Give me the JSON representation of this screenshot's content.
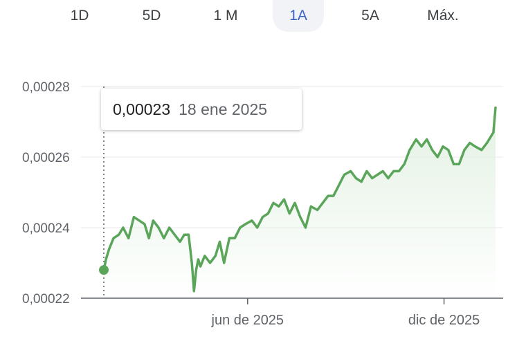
{
  "range_tabs": [
    {
      "label": "1D",
      "active": false
    },
    {
      "label": "5D",
      "active": false
    },
    {
      "label": "1 M",
      "active": false
    },
    {
      "label": "1A",
      "active": true
    },
    {
      "label": "5A",
      "active": false
    },
    {
      "label": "Máx.",
      "active": false
    }
  ],
  "tooltip": {
    "value": "0,00023",
    "date": "18 ene 2025"
  },
  "colors": {
    "line": "#5aa55a",
    "fill": "#e3f1e3",
    "grid": "#e8eaed",
    "axis": "#5f6368",
    "active_tab_text": "#3b62c7",
    "active_tab_bg": "#f1f3f6"
  },
  "chart_data": {
    "type": "area",
    "title": "",
    "xlabel": "",
    "ylabel": "",
    "grid": true,
    "legend": "none",
    "ylim": [
      0.00022,
      0.00028
    ],
    "yticks": [
      0.00022,
      0.00024,
      0.00026,
      0.00028
    ],
    "ytick_labels": [
      "0,00022",
      "0,00024",
      "0,00026",
      "0,00028"
    ],
    "xlim": [
      "2025-01-18",
      "2026-01-18"
    ],
    "xticks": [
      "2025-06-01",
      "2025-12-01"
    ],
    "xtick_labels": [
      "jun de 2025",
      "dic de 2025"
    ],
    "highlight": {
      "x": "2025-01-18",
      "y": 0.000228
    },
    "series": [
      {
        "x": [
          "2025-01-18",
          "2025-01-20",
          "2025-01-23",
          "2025-01-27",
          "2025-02-01",
          "2025-02-05",
          "2025-02-10",
          "2025-02-15",
          "2025-02-20",
          "2025-02-25",
          "2025-03-01",
          "2025-03-05",
          "2025-03-10",
          "2025-03-15",
          "2025-03-20",
          "2025-03-25",
          "2025-03-30",
          "2025-04-03",
          "2025-04-07",
          "2025-04-10",
          "2025-04-12",
          "2025-04-14",
          "2025-04-16",
          "2025-04-18",
          "2025-04-22",
          "2025-04-27",
          "2025-05-02",
          "2025-05-06",
          "2025-05-10",
          "2025-05-15",
          "2025-05-20",
          "2025-05-25",
          "2025-05-30",
          "2025-06-05",
          "2025-06-10",
          "2025-06-15",
          "2025-06-20",
          "2025-06-25",
          "2025-06-30",
          "2025-07-05",
          "2025-07-10",
          "2025-07-15",
          "2025-07-20",
          "2025-07-25",
          "2025-07-30",
          "2025-08-05",
          "2025-08-10",
          "2025-08-15",
          "2025-08-20",
          "2025-08-25",
          "2025-08-30",
          "2025-09-05",
          "2025-09-10",
          "2025-09-15",
          "2025-09-20",
          "2025-09-25",
          "2025-09-30",
          "2025-10-05",
          "2025-10-10",
          "2025-10-15",
          "2025-10-20",
          "2025-10-25",
          "2025-10-30",
          "2025-11-05",
          "2025-11-10",
          "2025-11-15",
          "2025-11-20",
          "2025-11-25",
          "2025-11-30",
          "2025-12-05",
          "2025-12-10",
          "2025-12-15",
          "2025-12-20",
          "2025-12-25",
          "2025-12-30",
          "2026-01-05",
          "2026-01-10",
          "2026-01-14",
          "2026-01-16",
          "2026-01-18"
        ],
        "values": [
          0.000228,
          0.000231,
          0.000234,
          0.000237,
          0.000238,
          0.00024,
          0.000237,
          0.000243,
          0.000242,
          0.000241,
          0.000237,
          0.000242,
          0.00024,
          0.000237,
          0.00024,
          0.000238,
          0.000236,
          0.000238,
          0.000238,
          0.00023,
          0.000222,
          0.000228,
          0.000231,
          0.000229,
          0.000232,
          0.00023,
          0.000232,
          0.000236,
          0.00023,
          0.000237,
          0.000237,
          0.00024,
          0.000241,
          0.000242,
          0.00024,
          0.000243,
          0.000244,
          0.000247,
          0.000246,
          0.000248,
          0.000244,
          0.000247,
          0.000243,
          0.00024,
          0.000246,
          0.000245,
          0.000247,
          0.000249,
          0.000249,
          0.000252,
          0.000255,
          0.000256,
          0.000254,
          0.000253,
          0.000256,
          0.000254,
          0.000255,
          0.000256,
          0.000254,
          0.000256,
          0.000256,
          0.000258,
          0.000262,
          0.000265,
          0.000263,
          0.000265,
          0.000262,
          0.00026,
          0.000263,
          0.000262,
          0.000258,
          0.000258,
          0.000262,
          0.000264,
          0.000263,
          0.000262,
          0.000264,
          0.000266,
          0.000267,
          0.000274
        ]
      }
    ]
  }
}
